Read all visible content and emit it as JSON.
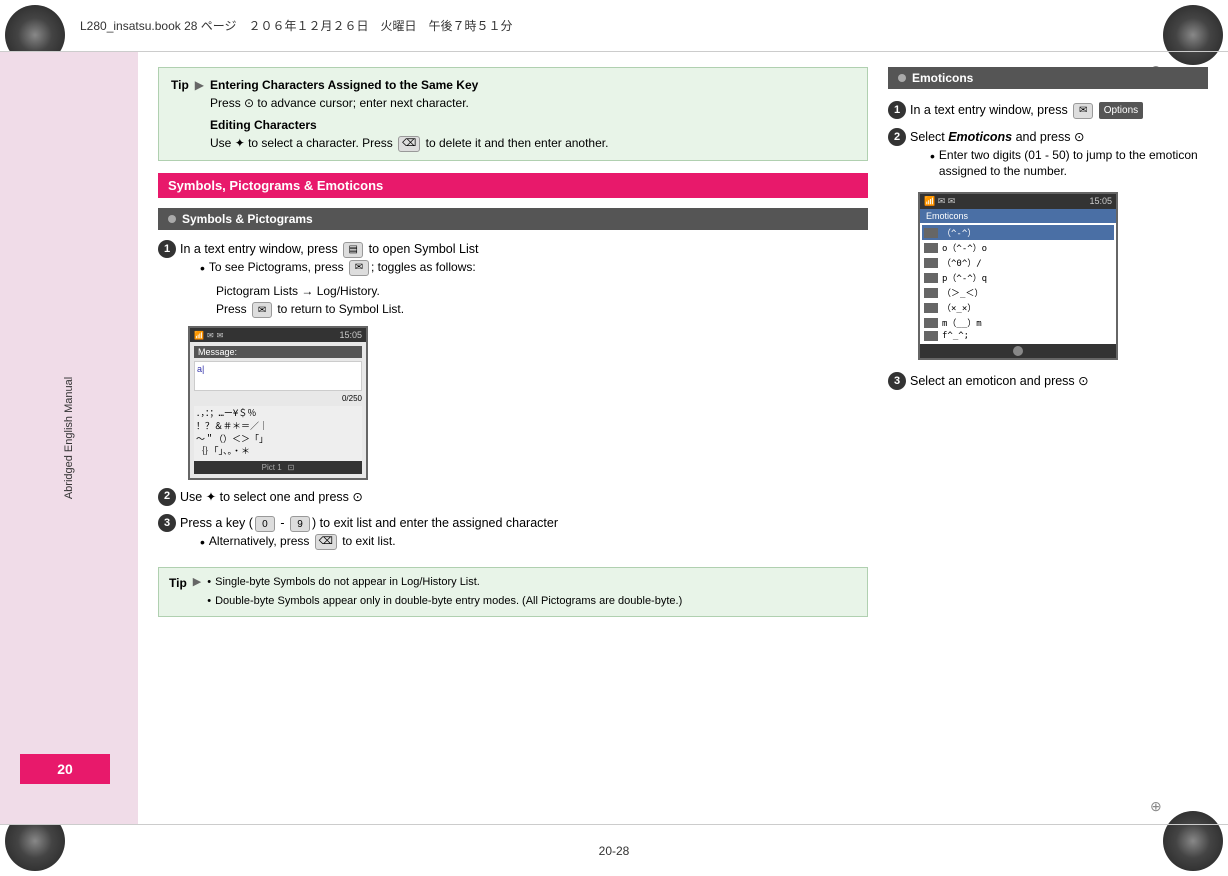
{
  "page": {
    "title": "L280_insatsu.book 28 ページ　２０６年１２月２６日　火曜日　午後７時５１分",
    "bottom_page": "20-28",
    "sidebar_label": "Abridged English Manual",
    "page_number": "20"
  },
  "tip_top": {
    "label": "Tip",
    "header": "Entering Characters Assigned to the Same Key",
    "lines": [
      "Press ⊙ to advance cursor; enter next character.",
      "Editing Characters",
      "Use ✦ to select a character. Press  to delete it",
      "and then enter another."
    ]
  },
  "symbols_section": {
    "title": "Symbols, Pictograms & Emoticons",
    "sub_title": "Symbols & Pictograms",
    "steps": [
      {
        "num": "1",
        "text": "In a text entry window, press",
        "key": "📷",
        "text2": "to open Symbol List",
        "bullets": [
          "To see Pictograms, press ✉; toggles as follows:",
          "Pictogram Lists → Log/History.",
          "Press ✉ to return to Symbol List."
        ]
      },
      {
        "num": "2",
        "text": "Use ✦ to select one and press ⊙"
      },
      {
        "num": "3",
        "text": "Press a key (",
        "key1": "0",
        "dash": " - ",
        "key2": "9",
        "text2": ") to exit list and enter the assigned character",
        "bullets": [
          "Alternatively, press  to exit list."
        ]
      }
    ],
    "tip_bottom": {
      "label": "Tip",
      "bullets": [
        "Single-byte Symbols do not appear in Log/History List.",
        "Double-byte Symbols appear only in double-byte entry modes. (All Pictograms are double-byte.)"
      ]
    }
  },
  "emoticons_section": {
    "title": "Emoticons",
    "steps": [
      {
        "num": "1",
        "text": "In a text entry window, press ✉",
        "badge": "Options"
      },
      {
        "num": "2",
        "text": "Select Emoticons and press ⊙",
        "bullets": [
          "Enter two digits (01 - 50) to jump to the emoticon assigned to the number."
        ]
      },
      {
        "num": "3",
        "text": "Select an emoticon and press ⊙"
      }
    ],
    "phone_screen": {
      "time": "15:05",
      "title": "Emoticons",
      "items": [
        {
          "label": "（^-^）",
          "selected": true
        },
        {
          "label": "o（^-^）o",
          "selected": false
        },
        {
          "label": "（^0^）/",
          "selected": false
        },
        {
          "label": "p（^-^）q",
          "selected": false
        },
        {
          "label": "（＞_＜）",
          "selected": false
        },
        {
          "label": "（×_×）",
          "selected": false
        },
        {
          "label": "m（__）m",
          "selected": false
        },
        {
          "label": "f^_^;",
          "selected": false
        }
      ]
    }
  },
  "phone_screen": {
    "title_left": "✉  ✉",
    "time": "15:05",
    "message_label": "Message:",
    "char_count": "0/250",
    "symbol_rows": [
      "．，：；…ー¥＄％",
      "！？＆＃＊＝／｜",
      "〜＂〃（）＜＞「」",
      "｛｝「」、。・＊"
    ],
    "bottom_label": "Pict 1"
  }
}
